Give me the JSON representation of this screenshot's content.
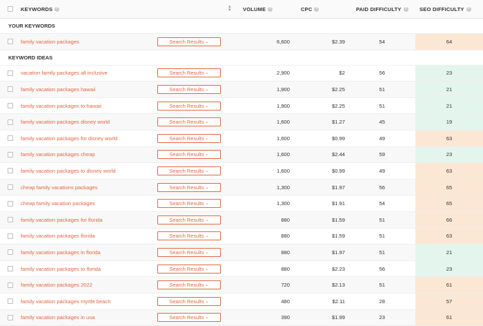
{
  "header": {
    "keywords": "KEYWORDS",
    "volume": "VOLUME",
    "cpc": "CPC",
    "paid_difficulty": "PAID DIFFICULTY",
    "seo_difficulty": "SEO DIFFICULTY",
    "info_glyph": "?",
    "sort_up": "▲",
    "sort_down": "▼"
  },
  "sections": {
    "your_keywords": "YOUR KEYWORDS",
    "keyword_ideas": "KEYWORD IDEAS"
  },
  "button_label": "Search Results",
  "button_chevron": "⌄",
  "colors": {
    "accent": "#e6653f",
    "seo_easy": "#e4f5ee",
    "seo_hard": "#fbe7d3"
  },
  "your_keywords": [
    {
      "keyword": "family vacation packages",
      "volume": "6,600",
      "cpc": "$2.39",
      "paid": "54",
      "seo": "64",
      "seo_level": "hard"
    }
  ],
  "keyword_ideas": [
    {
      "keyword": "vacation family packages all inclusive",
      "volume": "2,900",
      "cpc": "$2",
      "paid": "56",
      "seo": "23",
      "seo_level": "easy"
    },
    {
      "keyword": "family vacation packages hawaii",
      "volume": "1,900",
      "cpc": "$2.25",
      "paid": "51",
      "seo": "21",
      "seo_level": "easy"
    },
    {
      "keyword": "family vacation packages to hawaii",
      "volume": "1,900",
      "cpc": "$2.25",
      "paid": "51",
      "seo": "21",
      "seo_level": "easy"
    },
    {
      "keyword": "family vacation packages disney world",
      "volume": "1,600",
      "cpc": "$1.27",
      "paid": "45",
      "seo": "19",
      "seo_level": "easy"
    },
    {
      "keyword": "family vacation packages for disney world",
      "volume": "1,600",
      "cpc": "$0.99",
      "paid": "49",
      "seo": "63",
      "seo_level": "hard"
    },
    {
      "keyword": "family vacation packages cheap",
      "volume": "1,600",
      "cpc": "$2.44",
      "paid": "59",
      "seo": "23",
      "seo_level": "easy"
    },
    {
      "keyword": "family vacation packages to disney world",
      "volume": "1,600",
      "cpc": "$0.99",
      "paid": "49",
      "seo": "63",
      "seo_level": "hard"
    },
    {
      "keyword": "cheap family vacations packages",
      "volume": "1,300",
      "cpc": "$1.97",
      "paid": "56",
      "seo": "65",
      "seo_level": "hard"
    },
    {
      "keyword": "cheap family vacation packages",
      "volume": "1,300",
      "cpc": "$1.91",
      "paid": "54",
      "seo": "65",
      "seo_level": "hard"
    },
    {
      "keyword": "family vacation packages for florida",
      "volume": "880",
      "cpc": "$1.59",
      "paid": "51",
      "seo": "66",
      "seo_level": "hard"
    },
    {
      "keyword": "family vacation packages florida",
      "volume": "880",
      "cpc": "$1.59",
      "paid": "51",
      "seo": "63",
      "seo_level": "hard"
    },
    {
      "keyword": "family vacation packages in florida",
      "volume": "880",
      "cpc": "$1.97",
      "paid": "51",
      "seo": "21",
      "seo_level": "easy"
    },
    {
      "keyword": "family vacation packages to florida",
      "volume": "880",
      "cpc": "$2.23",
      "paid": "56",
      "seo": "23",
      "seo_level": "easy"
    },
    {
      "keyword": "family vacation packages 2022",
      "volume": "720",
      "cpc": "$2.13",
      "paid": "51",
      "seo": "61",
      "seo_level": "hard"
    },
    {
      "keyword": "family vacation packages myrtle beach",
      "volume": "480",
      "cpc": "$2.11",
      "paid": "28",
      "seo": "57",
      "seo_level": "hard"
    },
    {
      "keyword": "family vacation packages in usa",
      "volume": "390",
      "cpc": "$1.99",
      "paid": "23",
      "seo": "61",
      "seo_level": "hard"
    }
  ]
}
